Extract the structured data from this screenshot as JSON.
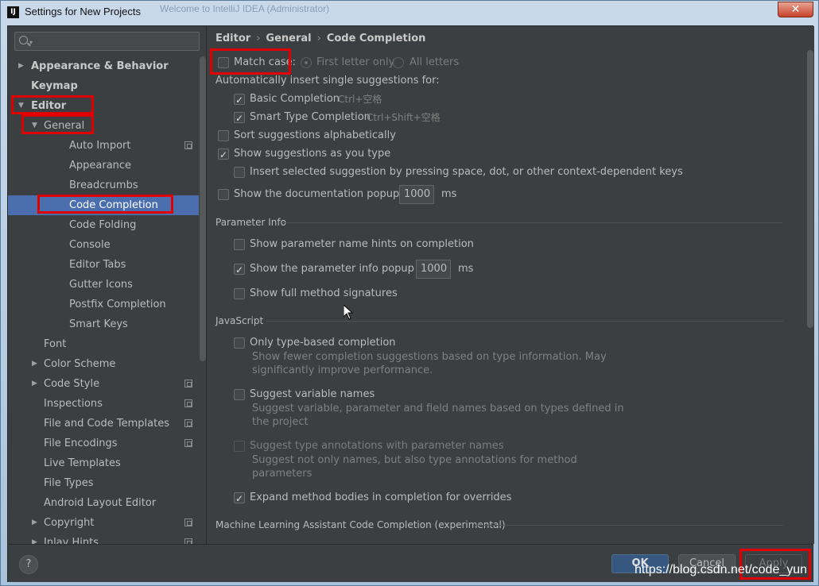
{
  "window": {
    "title": "Settings for New Projects",
    "background_title": "Welcome to IntelliJ IDEA (Administrator)",
    "close_label": "✕"
  },
  "search": {
    "placeholder": ""
  },
  "sidebar": {
    "items": [
      {
        "label": "Appearance & Behavior",
        "level": 0,
        "arrow": "▶",
        "bold": true
      },
      {
        "label": "Keymap",
        "level": 0,
        "arrow": "",
        "bold": true
      },
      {
        "label": "Editor",
        "level": 0,
        "arrow": "▼",
        "bold": true
      },
      {
        "label": "General",
        "level": 1,
        "arrow": "▼"
      },
      {
        "label": "Auto Import",
        "level": 2,
        "page_icon": true
      },
      {
        "label": "Appearance",
        "level": 2
      },
      {
        "label": "Breadcrumbs",
        "level": 2
      },
      {
        "label": "Code Completion",
        "level": 2,
        "selected": true
      },
      {
        "label": "Code Folding",
        "level": 2
      },
      {
        "label": "Console",
        "level": 2
      },
      {
        "label": "Editor Tabs",
        "level": 2
      },
      {
        "label": "Gutter Icons",
        "level": 2
      },
      {
        "label": "Postfix Completion",
        "level": 2
      },
      {
        "label": "Smart Keys",
        "level": 2
      },
      {
        "label": "Font",
        "level": 1
      },
      {
        "label": "Color Scheme",
        "level": 1,
        "arrow": "▶"
      },
      {
        "label": "Code Style",
        "level": 1,
        "arrow": "▶",
        "page_icon": true
      },
      {
        "label": "Inspections",
        "level": 1,
        "page_icon": true
      },
      {
        "label": "File and Code Templates",
        "level": 1,
        "page_icon": true
      },
      {
        "label": "File Encodings",
        "level": 1,
        "page_icon": true
      },
      {
        "label": "Live Templates",
        "level": 1
      },
      {
        "label": "File Types",
        "level": 1
      },
      {
        "label": "Android Layout Editor",
        "level": 1
      },
      {
        "label": "Copyright",
        "level": 1,
        "arrow": "▶",
        "page_icon": true
      },
      {
        "label": "Inlay Hints",
        "level": 1,
        "arrow": "▶",
        "page_icon": true
      }
    ]
  },
  "breadcrumb": {
    "a": "Editor",
    "b": "General",
    "c": "Code Completion",
    "sep": "›"
  },
  "main": {
    "match_case": "Match case:",
    "first_letter": "First letter only",
    "all_letters": "All letters",
    "auto_insert": "Automatically insert single suggestions for:",
    "basic": "Basic Completion",
    "basic_sc": "Ctrl+空格",
    "smart": "Smart Type Completion",
    "smart_sc": "Ctrl+Shift+空格",
    "sort": "Sort suggestions alphabetically",
    "show_typing": "Show suggestions as you type",
    "insert_sel": "Insert selected suggestion by pressing space, dot, or other context-dependent keys",
    "doc_popup": "Show the documentation popup in",
    "doc_ms": "1000",
    "ms": "ms",
    "param_info": "Parameter Info",
    "param_hints": "Show parameter name hints on completion",
    "param_popup": "Show the parameter info popup in",
    "param_ms": "1000",
    "full_sig": "Show full method signatures",
    "js": "JavaScript",
    "only_type": "Only type-based completion",
    "only_type_d1": "Show fewer completion suggestions based on type information. May",
    "only_type_d2": "significantly improve performance.",
    "suggest_var": "Suggest variable names",
    "suggest_var_d1": "Suggest variable, parameter and field names based on types defined in",
    "suggest_var_d2": "the project",
    "suggest_ann": "Suggest type annotations with parameter names",
    "suggest_ann_d1": "Suggest not only names, but also type annotations for method",
    "suggest_ann_d2": "parameters",
    "expand": "Expand method bodies in completion for overrides",
    "ml": "Machine Learning Assistant Code Completion (experimental)"
  },
  "footer": {
    "help": "?",
    "ok": "OK",
    "cancel": "Cancel",
    "apply": "Apply"
  },
  "watermark": "https://blog.csdn.net/code_yun",
  "colors": {
    "selection": "#4b6eaf",
    "highlight_box": "#e00000",
    "background": "#3c3f41"
  }
}
